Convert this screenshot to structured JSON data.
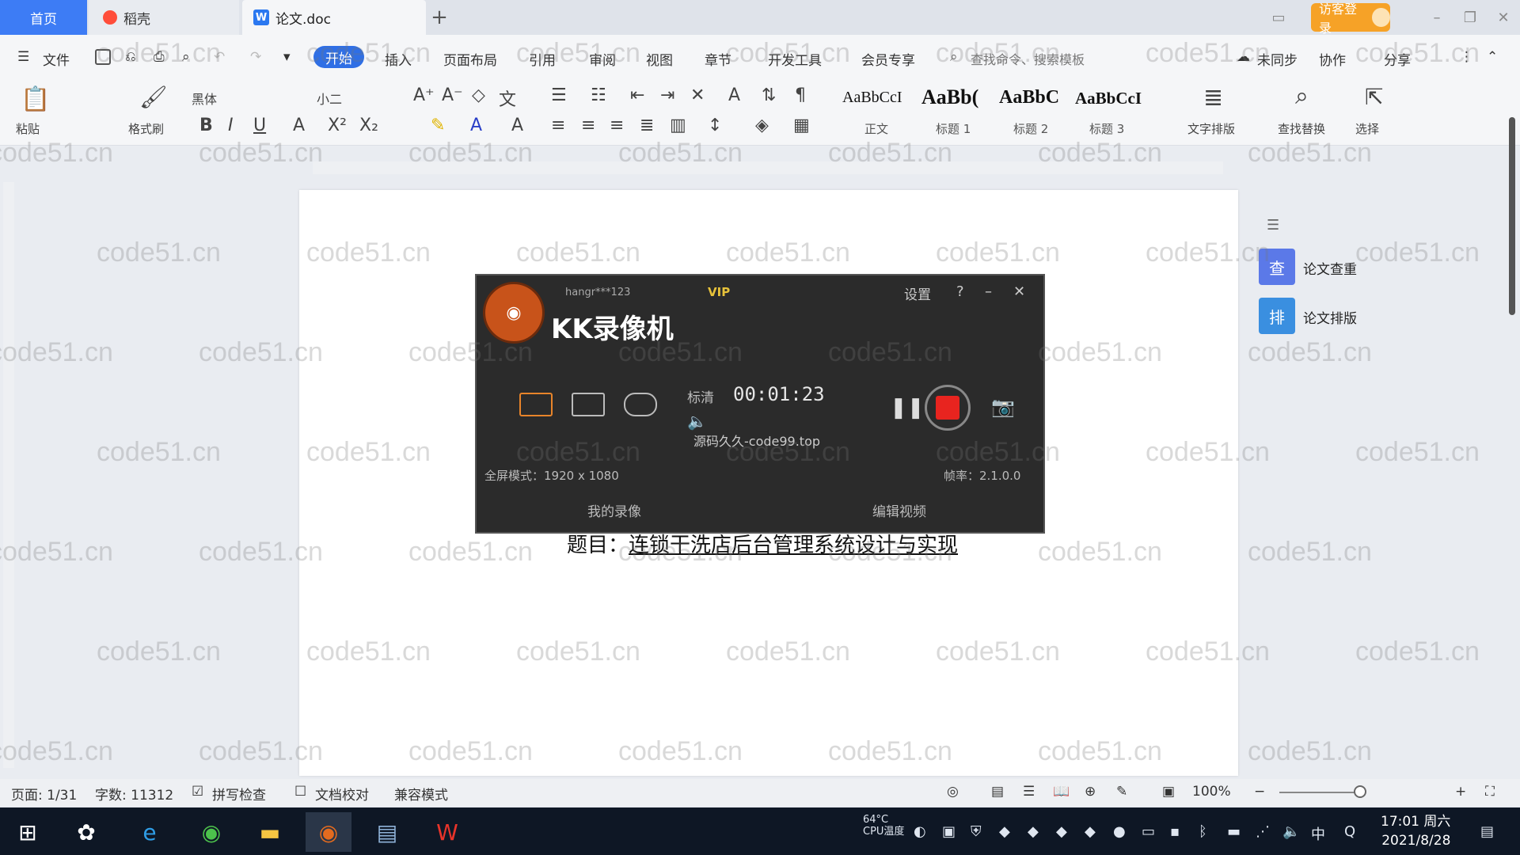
{
  "tabs": {
    "home": "首页",
    "daoke": "稻壳",
    "doc": "论文.doc",
    "add": "+"
  },
  "topright": {
    "login": "访客登录"
  },
  "menu": {
    "file": "文件",
    "items": [
      "开始",
      "插入",
      "页面布局",
      "引用",
      "审阅",
      "视图",
      "章节",
      "开发工具",
      "会员专享"
    ],
    "search_cmd": "查找命令、搜索模板",
    "sync": "未同步",
    "collab": "协作",
    "share": "分享"
  },
  "toolbar": {
    "paste": "粘贴",
    "format_painter": "格式刷",
    "font": "黑体",
    "font_size": "小二",
    "styles": [
      {
        "preview": "AaBbCcI",
        "label": "正文"
      },
      {
        "preview": "AaBb(",
        "label": "标题 1"
      },
      {
        "preview": "AaBbC",
        "label": "标题 2"
      },
      {
        "preview": "AaBbCcI",
        "label": "标题 3"
      }
    ],
    "text_layout": "文字排版",
    "find_replace": "查找替换",
    "select": "选择"
  },
  "recorder": {
    "user": "hangr***123",
    "vip": "VIP",
    "settings": "设置",
    "help": "?",
    "title": "KK录像机",
    "quality": "标清",
    "time": "00:01:23",
    "watermark": "源码久久-code99.top",
    "mode": "全屏模式：1920 x 1080",
    "fps": "帧率：2.1.0.0",
    "my_recordings": "我的录像",
    "edit_video": "编辑视频"
  },
  "document": {
    "title_prefix": "题目：",
    "title_text": "连锁干洗店后台管理系统设计与实现"
  },
  "right_panel": {
    "check": "论文查重",
    "format": "论文排版"
  },
  "status": {
    "page": "页面: 1/31",
    "words": "字数: 11312",
    "spell": "拼写检查",
    "proof": "文档校对",
    "compat": "兼容模式",
    "zoom": "100%"
  },
  "taskbar": {
    "cpu": "64°C CPU温度",
    "ime": "中",
    "time": "17:01 周六",
    "date": "2021/8/28"
  },
  "watermark_text": "code51.cn"
}
